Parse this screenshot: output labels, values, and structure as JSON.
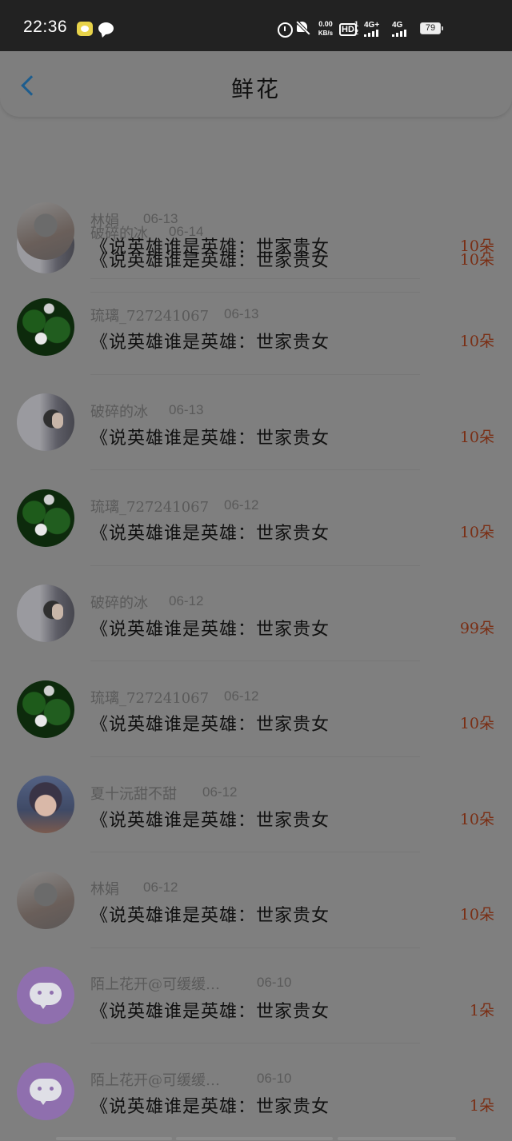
{
  "status": {
    "time": "22:36",
    "netspeed_value": "0.00",
    "netspeed_unit": "KB/s",
    "hd": "HD",
    "sim1": "1",
    "sim2": "2",
    "net1": "4G+",
    "net2": "4G",
    "battery": "79"
  },
  "header": {
    "title": "鲜花"
  },
  "rows": [
    {
      "name": "破碎的冰",
      "date": "06-14",
      "book": "《说英雄谁是英雄：世家贵女",
      "count": "10朵"
    },
    {
      "name": "林娟",
      "date": "06-13",
      "book": "《说英雄谁是英雄：世家贵女",
      "count": "10朵"
    },
    {
      "name": "琉璃_727241067",
      "date": "06-13",
      "book": "《说英雄谁是英雄：世家贵女",
      "count": "10朵"
    },
    {
      "name": "破碎的冰",
      "date": "06-13",
      "book": "《说英雄谁是英雄：世家贵女",
      "count": "10朵"
    },
    {
      "name": "琉璃_727241067",
      "date": "06-12",
      "book": "《说英雄谁是英雄：世家贵女",
      "count": "10朵"
    },
    {
      "name": "破碎的冰",
      "date": "06-12",
      "book": "《说英雄谁是英雄：世家贵女",
      "count": "99朵"
    },
    {
      "name": "琉璃_727241067",
      "date": "06-12",
      "book": "《说英雄谁是英雄：世家贵女",
      "count": "10朵"
    },
    {
      "name": "夏十沅甜不甜",
      "date": "06-12",
      "book": "《说英雄谁是英雄：世家贵女",
      "count": "10朵"
    },
    {
      "name": "林娟",
      "date": "06-12",
      "book": "《说英雄谁是英雄：世家贵女",
      "count": "10朵"
    },
    {
      "name": "陌上花开@可缓缓…",
      "date": "06-10",
      "book": "《说英雄谁是英雄：世家贵女",
      "count": "1朵"
    },
    {
      "name": "陌上花开@可缓缓…",
      "date": "06-10",
      "book": "《说英雄谁是英雄：世家贵女",
      "count": "1朵"
    }
  ]
}
